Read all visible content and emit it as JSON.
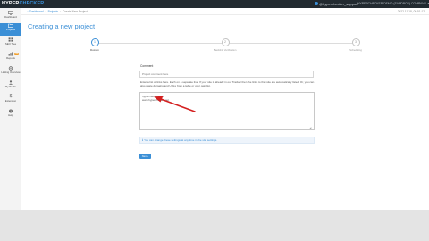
{
  "app": {
    "logo_main": "HYPER",
    "logo_accent": "CHECKER",
    "user": "@hyperchecker_support",
    "org": "HYPERCHECKER DEMO (SANDBOX) COMPANY"
  },
  "sidebar": {
    "items": [
      {
        "label": "Dashboard",
        "icon": "monitor-icon"
      },
      {
        "label": "Projects",
        "icon": "folder-icon"
      },
      {
        "label": "SEO Tree",
        "icon": "grid-icon"
      },
      {
        "label": "Reports",
        "icon": "chart-icon",
        "badge": "68"
      },
      {
        "label": "Linking Overview",
        "icon": "gear-icon"
      },
      {
        "label": "My Profile",
        "icon": "user-icon"
      },
      {
        "label": "Extension",
        "icon": "dollar-icon"
      },
      {
        "label": "Help",
        "icon": "help-icon"
      }
    ]
  },
  "breadcrumb": {
    "home": "Dashboard",
    "projects": "Projects",
    "current": "Create New Project"
  },
  "timestamp": "2022-11-18, 09:51:12",
  "page": {
    "title": "Creating a new project"
  },
  "wizard": {
    "steps": [
      {
        "number": "1",
        "label": "Domain"
      },
      {
        "number": "2",
        "label": "Backlink Verification"
      },
      {
        "number": "3",
        "label": "Scheduling"
      }
    ]
  },
  "form": {
    "name_label": "Comment",
    "name_placeholder": "Project comment here",
    "instructions": "Enter a list of links here. Each on a separate line. If your site is already in our Tracker then the links to that site are automatically listed. Or, you can also paste domains and URLs from a table or your own list.",
    "urls_line1": "hyperchecker.com",
    "urls_line2": "www.hyperchecker.net",
    "hint": "You can change these settings at any time in the site settings.",
    "next_label": "Next"
  },
  "colors": {
    "accent": "#3b8fd6",
    "annotation": "#d42020",
    "topbar": "#222a30"
  }
}
